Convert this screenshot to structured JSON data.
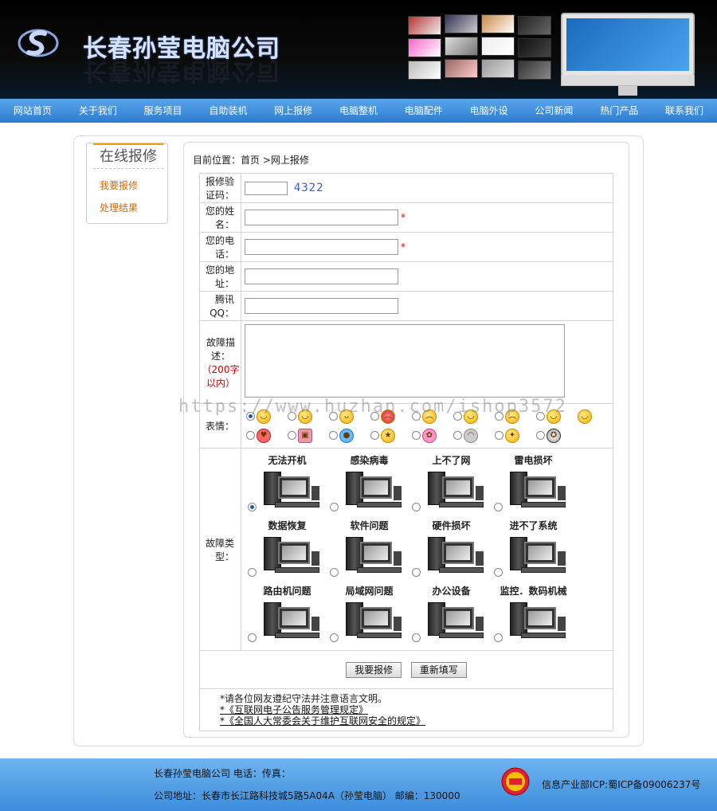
{
  "header": {
    "company_name": "长春孙莹电脑公司"
  },
  "nav": {
    "items": [
      "网站首页",
      "关于我们",
      "服务项目",
      "自助装机",
      "网上报修",
      "电脑整机",
      "电脑配件",
      "电脑外设",
      "公司新闻",
      "热门产品",
      "联系我们"
    ]
  },
  "sidebar": {
    "title": "在线报修",
    "links": [
      "我要报修",
      "处理结果"
    ]
  },
  "breadcrumb": {
    "label": "目前位置：",
    "home": "首页",
    "sep": ">",
    "current": "网上报修"
  },
  "form": {
    "captcha_label": "报修验证码：",
    "captcha_value": "",
    "captcha_code": "4322",
    "name_label": "您的姓名：",
    "name_value": "",
    "phone_label": "您的电话：",
    "phone_value": "",
    "address_label": "您的地址：",
    "address_value": "",
    "qq_label": "腾讯QQ：",
    "qq_value": "",
    "desc_label": "故障描述：",
    "desc_hint": "（200字以内）",
    "required_mark": "*",
    "emotion_label": "表情：",
    "emotion_icons": [
      "grin-icon",
      "smile-icon",
      "tongue-icon",
      "angry-icon",
      "cry-icon",
      "cool-icon",
      "worried-icon",
      "laugh-icon",
      "shy-icon",
      "heart-icon",
      "gift-icon",
      "drop-icon",
      "star-icon",
      "flower-icon",
      "ghost-icon",
      "bulb-icon",
      "soccer-icon"
    ],
    "fault_label": "故障类型：",
    "fault_types": [
      "无法开机",
      "感染病毒",
      "上不了网",
      "雷电损坏",
      "数据恢复",
      "软件问题",
      "硬件损坏",
      "进不了系统",
      "路由机问题",
      "局域网问题",
      "办公设备",
      "监控．数码机械"
    ],
    "submit_label": "我要报修",
    "reset_label": "重新填写",
    "notes": [
      "*请各位网友遵纪守法并注意语言文明。",
      "*《互联网电子公告服务管理规定》",
      "*《全国人大常委会关于维护互联网安全的规定》"
    ]
  },
  "watermark": "https://www.huzhan.com/ishop3572",
  "footer": {
    "line1": "长春孙莹电脑公司 电话：传真：",
    "line2": "公司地址：长春市长江路科技城5路5A04A（孙莹电脑） 邮编：130000",
    "icp": "信息产业部ICP:蜀ICP备09006237号"
  },
  "colors": {
    "nav_top": "#5aa4ea",
    "nav_bottom": "#2c7dd0",
    "accent_orange": "#d46a00",
    "footer": "#3b8ddc"
  }
}
